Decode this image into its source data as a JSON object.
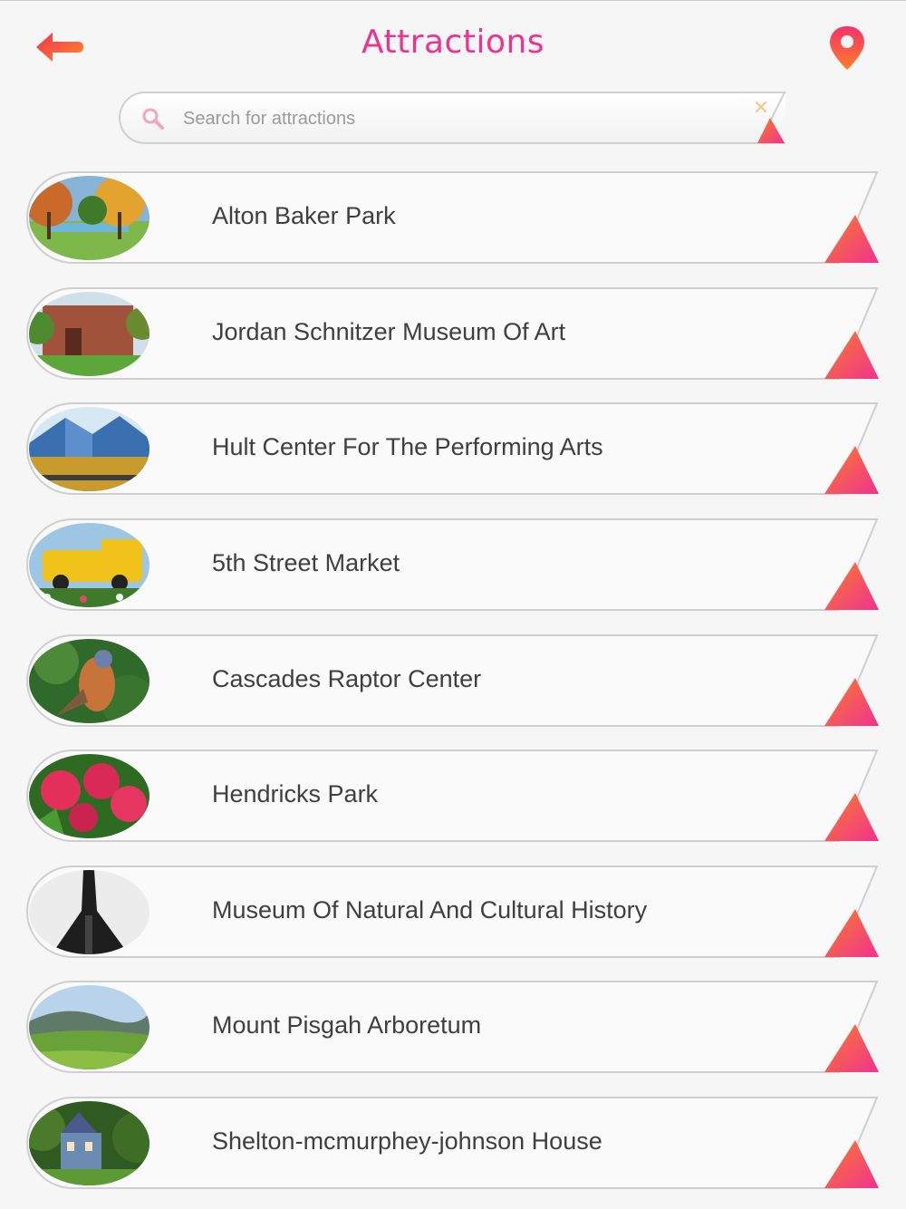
{
  "header": {
    "title": "Attractions",
    "back_icon": "arrow-left-icon",
    "map_icon": "map-pin-icon"
  },
  "search": {
    "placeholder": "Search for attractions",
    "value": "",
    "icon": "search-icon",
    "clear_icon": "close-icon"
  },
  "colors": {
    "accent": "#f0328f",
    "accent_orange": "#fb7d2a",
    "list_text": "#3f3f3f",
    "background": "#f6f6f6"
  },
  "attractions": [
    {
      "name": "Alton Baker Park"
    },
    {
      "name": "Jordan Schnitzer Museum Of Art"
    },
    {
      "name": "Hult Center For The Performing Arts"
    },
    {
      "name": "5th Street Market"
    },
    {
      "name": "Cascades Raptor Center"
    },
    {
      "name": "Hendricks Park"
    },
    {
      "name": "Museum Of Natural And Cultural History"
    },
    {
      "name": "Mount Pisgah Arboretum"
    },
    {
      "name": "Shelton-mcmurphey-johnson House"
    }
  ]
}
